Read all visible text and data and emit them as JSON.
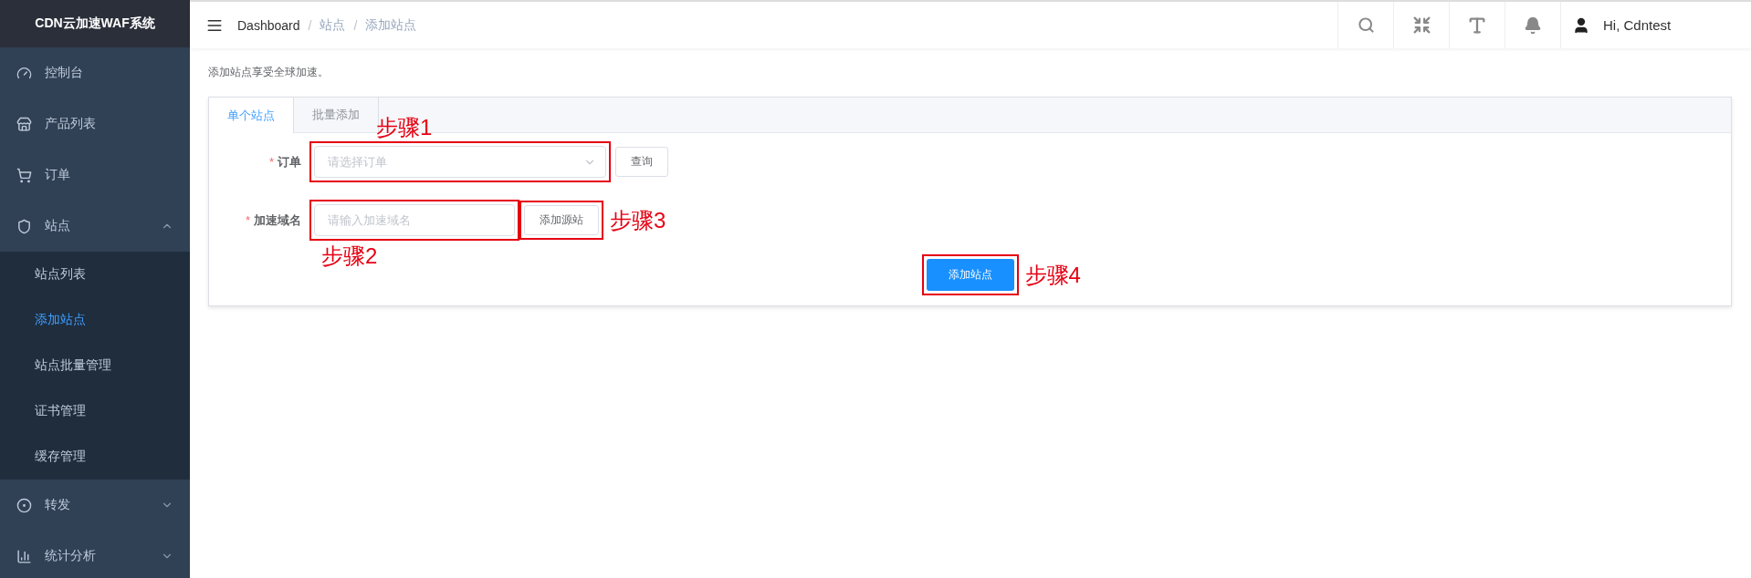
{
  "sidebar": {
    "title": "CDN云加速WAF系统",
    "items": [
      {
        "label": "控制台",
        "kind": "link"
      },
      {
        "label": "产品列表",
        "kind": "link"
      },
      {
        "label": "订单",
        "kind": "link"
      },
      {
        "label": "站点",
        "kind": "group",
        "expanded": true,
        "children": [
          {
            "label": "站点列表",
            "selected": false
          },
          {
            "label": "添加站点",
            "selected": true
          },
          {
            "label": "站点批量管理",
            "selected": false
          },
          {
            "label": "证书管理",
            "selected": false
          },
          {
            "label": "缓存管理",
            "selected": false
          }
        ]
      },
      {
        "label": "转发",
        "kind": "group",
        "expanded": false
      },
      {
        "label": "统计分析",
        "kind": "group",
        "expanded": false
      }
    ]
  },
  "header": {
    "breadcrumb": [
      {
        "label": "Dashboard",
        "kind": "link"
      },
      {
        "label": "站点",
        "kind": "text"
      },
      {
        "label": "添加站点",
        "kind": "text"
      }
    ],
    "separator": "/",
    "user": "Hi, Cdntest"
  },
  "page": {
    "description": "添加站点享受全球加速。",
    "tabs": [
      {
        "label": "单个站点",
        "selected": true
      },
      {
        "label": "批量添加",
        "selected": false
      }
    ],
    "form": {
      "rows": [
        {
          "required_mark": "*",
          "label": "订单",
          "field": {
            "kind": "select",
            "placeholder": "请选择订单",
            "annotation": {
              "text": "步骤1",
              "kind": "above"
            }
          },
          "button": {
            "label": "查询"
          }
        },
        {
          "required_mark": "*",
          "label": "加速域名",
          "field": {
            "kind": "input",
            "placeholder": "请输入加速域名",
            "annotation": {
              "text": "步骤2",
              "kind": "below"
            }
          },
          "button": {
            "label": "添加源站",
            "annotation": {
              "text": "步骤3",
              "kind": "beside"
            }
          }
        }
      ],
      "submit": {
        "label": "添加站点",
        "annotation": {
          "text": "步骤4",
          "kind": "beside"
        }
      }
    }
  }
}
